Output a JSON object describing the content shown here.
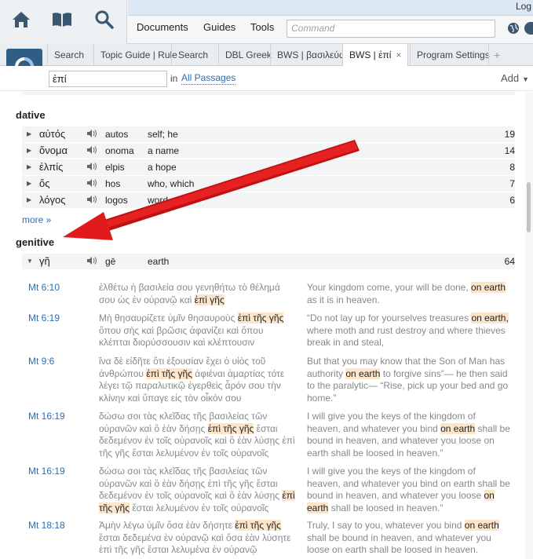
{
  "header": {
    "login_text": "Log",
    "menu": [
      "Documents",
      "Guides",
      "Tools"
    ],
    "command_placeholder": "Command"
  },
  "tabs": [
    {
      "label": "Search"
    },
    {
      "label": "Topic Guide | Rule"
    },
    {
      "label": "Search"
    },
    {
      "label": "DBL Greek"
    },
    {
      "label": "BWS | βασιλεύω"
    },
    {
      "label": "BWS | ἐπί",
      "active": true,
      "close": "×"
    },
    {
      "label": "Program Settings"
    }
  ],
  "tab_plus": "+",
  "search": {
    "query": "ἐπί",
    "in_label": "in",
    "scope": "All Passages",
    "add_label": "Add",
    "add_caret": "▼"
  },
  "dative": {
    "title": "dative",
    "rows": [
      {
        "lemma": "αὐτός",
        "translit": "autos",
        "gloss": "self; he",
        "count": "19"
      },
      {
        "lemma": "ὄνομα",
        "translit": "onoma",
        "gloss": "a name",
        "count": "14"
      },
      {
        "lemma": "ἐλπίς",
        "translit": "elpis",
        "gloss": "a hope",
        "count": "8"
      },
      {
        "lemma": "ὅς",
        "translit": "hos",
        "gloss": "who, which",
        "count": "7"
      },
      {
        "lemma": "λόγος",
        "translit": "logos",
        "gloss": "word",
        "count": "6"
      }
    ],
    "more": "more »"
  },
  "genitive": {
    "title": "genitive",
    "row": {
      "lemma": "γῆ",
      "translit": "gē",
      "gloss": "earth",
      "count": "64"
    }
  },
  "verses": [
    {
      "ref": "Mt 6:10",
      "greek": [
        {
          "t": "ἐλθέτω ἡ βασιλεία σου γενηθήτω τὸ θέλημά σου ὡς ἐν οὐρανῷ καὶ "
        },
        {
          "t": "ἐπὶ γῆς",
          "h": true
        }
      ],
      "eng": [
        {
          "t": "Your kingdom come, your will be done, "
        },
        {
          "t": "on earth",
          "h": true
        },
        {
          "t": " as it is in heaven."
        }
      ]
    },
    {
      "ref": "Mt 6:19",
      "greek": [
        {
          "t": "Μὴ θησαυρίζετε ὑμῖν θησαυροὺς "
        },
        {
          "t": "ἐπὶ τῆς γῆς",
          "h": true
        },
        {
          "t": " ὅπου σὴς καὶ βρῶσις ἀφανίζει καὶ ὅπου κλέπται διορύσσουσιν καὶ κλέπτουσιν"
        }
      ],
      "eng": [
        {
          "t": "“Do not lay up for yourselves treasures "
        },
        {
          "t": "on earth,",
          "h": true
        },
        {
          "t": " where moth and rust destroy and where thieves break in and steal,"
        }
      ]
    },
    {
      "ref": "Mt 9:6",
      "greek": [
        {
          "t": "ἵνα δὲ εἰδῆτε ὅτι ἐξουσίαν ἔχει ὁ υἱὸς τοῦ ἀνθρώπου "
        },
        {
          "t": "ἐπὶ τῆς γῆς",
          "h": true
        },
        {
          "t": " ἀφιέναι ἁμαρτίας τότε λέγει τῷ παραλυτικῷ ἐγερθεὶς ἆρόν σου τὴν κλίνην καὶ ὕπαγε εἰς τὸν οἶκόν σου"
        }
      ],
      "eng": [
        {
          "t": "But that you may know that the Son of Man has authority "
        },
        {
          "t": "on earth",
          "h": true
        },
        {
          "t": " to forgive sins”— he then said to the paralytic— “Rise, pick up your bed and go home.”"
        }
      ]
    },
    {
      "ref": "Mt 16:19",
      "greek": [
        {
          "t": "δώσω σοι τὰς κλεῖδας τῆς βασιλείας τῶν οὐρανῶν καὶ ὃ ἐὰν δήσῃς "
        },
        {
          "t": "ἐπὶ τῆς γῆς",
          "h": true
        },
        {
          "t": " ἔσται δεδεμένον ἐν τοῖς οὐρανοῖς καὶ ὃ ἐὰν λύσῃς ἐπὶ τῆς γῆς ἔσται λελυμένον ἐν τοῖς οὐρανοῖς"
        }
      ],
      "eng": [
        {
          "t": "I will give you the keys of the kingdom of heaven, and whatever you bind "
        },
        {
          "t": "on earth",
          "h": true
        },
        {
          "t": " shall be bound in heaven, and whatever you loose on earth shall be loosed in heaven.”"
        }
      ]
    },
    {
      "ref": "Mt 16:19",
      "greek": [
        {
          "t": "δώσω σοι τὰς κλεῖδας τῆς βασιλείας τῶν οὐρανῶν καὶ ὃ ἐὰν δήσῃς ἐπὶ τῆς γῆς ἔσται δεδεμένον ἐν τοῖς οὐρανοῖς καὶ ὃ ἐὰν λύσῃς "
        },
        {
          "t": "ἐπὶ τῆς γῆς",
          "h": true
        },
        {
          "t": " ἔσται λελυμένον ἐν τοῖς οὐρανοῖς"
        }
      ],
      "eng": [
        {
          "t": "I will give you the keys of the kingdom of heaven, and whatever you bind on earth shall be bound in heaven, and whatever you loose "
        },
        {
          "t": "on earth",
          "h": true
        },
        {
          "t": " shall be loosed in heaven.”"
        }
      ]
    },
    {
      "ref": "Mt 18:18",
      "greek": [
        {
          "t": "Ἀμὴν λέγω ὑμῖν ὅσα ἐὰν δήσητε "
        },
        {
          "t": "ἐπὶ τῆς γῆς",
          "h": true
        },
        {
          "t": " ἔσται δεδεμένα ἐν οὐρανῷ καὶ ὅσα ἐὰν λύσητε ἐπὶ τῆς γῆς ἔσται λελυμένα ἐν οὐρανῷ"
        }
      ],
      "eng": [
        {
          "t": "Truly, I say to you, whatever you bind "
        },
        {
          "t": "on earth",
          "h": true
        },
        {
          "t": " shall be bound in heaven, and whatever you loose on earth shall be loosed in heaven."
        }
      ]
    }
  ],
  "colors": {
    "accent": "#2a6fb5",
    "highlight": "#fde5c9",
    "arrow": "#e01a1a",
    "logo": "#2e5e86"
  }
}
